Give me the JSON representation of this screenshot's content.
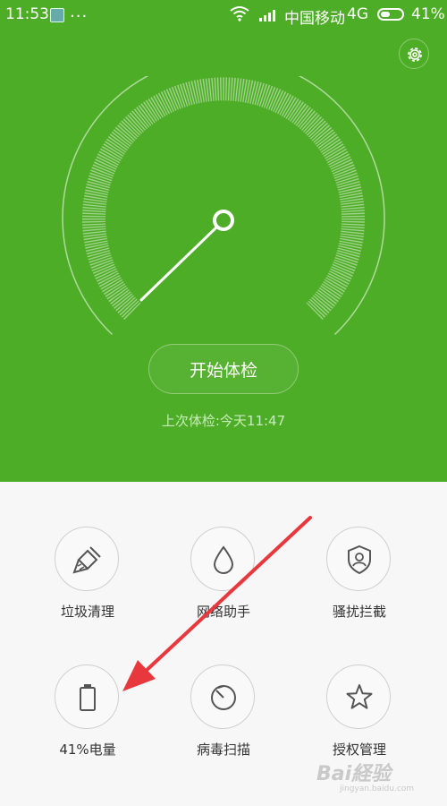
{
  "status_bar": {
    "time": "11:53",
    "dots": "...",
    "carrier": "中国移动",
    "network": "4G",
    "battery_pct": "41%"
  },
  "gauge": {
    "icon": "speedometer-gauge",
    "color": "#ffffff",
    "background": "#4ead27"
  },
  "start_button": {
    "label": "开始体检"
  },
  "last_check": {
    "text": "上次体检:今天11:47"
  },
  "tools": [
    {
      "label": "垃圾清理",
      "icon": "broom-icon"
    },
    {
      "label": "网络助手",
      "icon": "water-drop-icon"
    },
    {
      "label": "骚扰拦截",
      "icon": "shield-user-icon"
    },
    {
      "label": "41%电量",
      "icon": "battery-icon"
    },
    {
      "label": "病毒扫描",
      "icon": "virus-scan-icon"
    },
    {
      "label": "授权管理",
      "icon": "star-icon"
    }
  ],
  "watermark": {
    "text": "Bai経验",
    "sub": "jingyan.baidu.com"
  },
  "colors": {
    "accent": "#4ead27",
    "arrow": "#e8383d"
  }
}
